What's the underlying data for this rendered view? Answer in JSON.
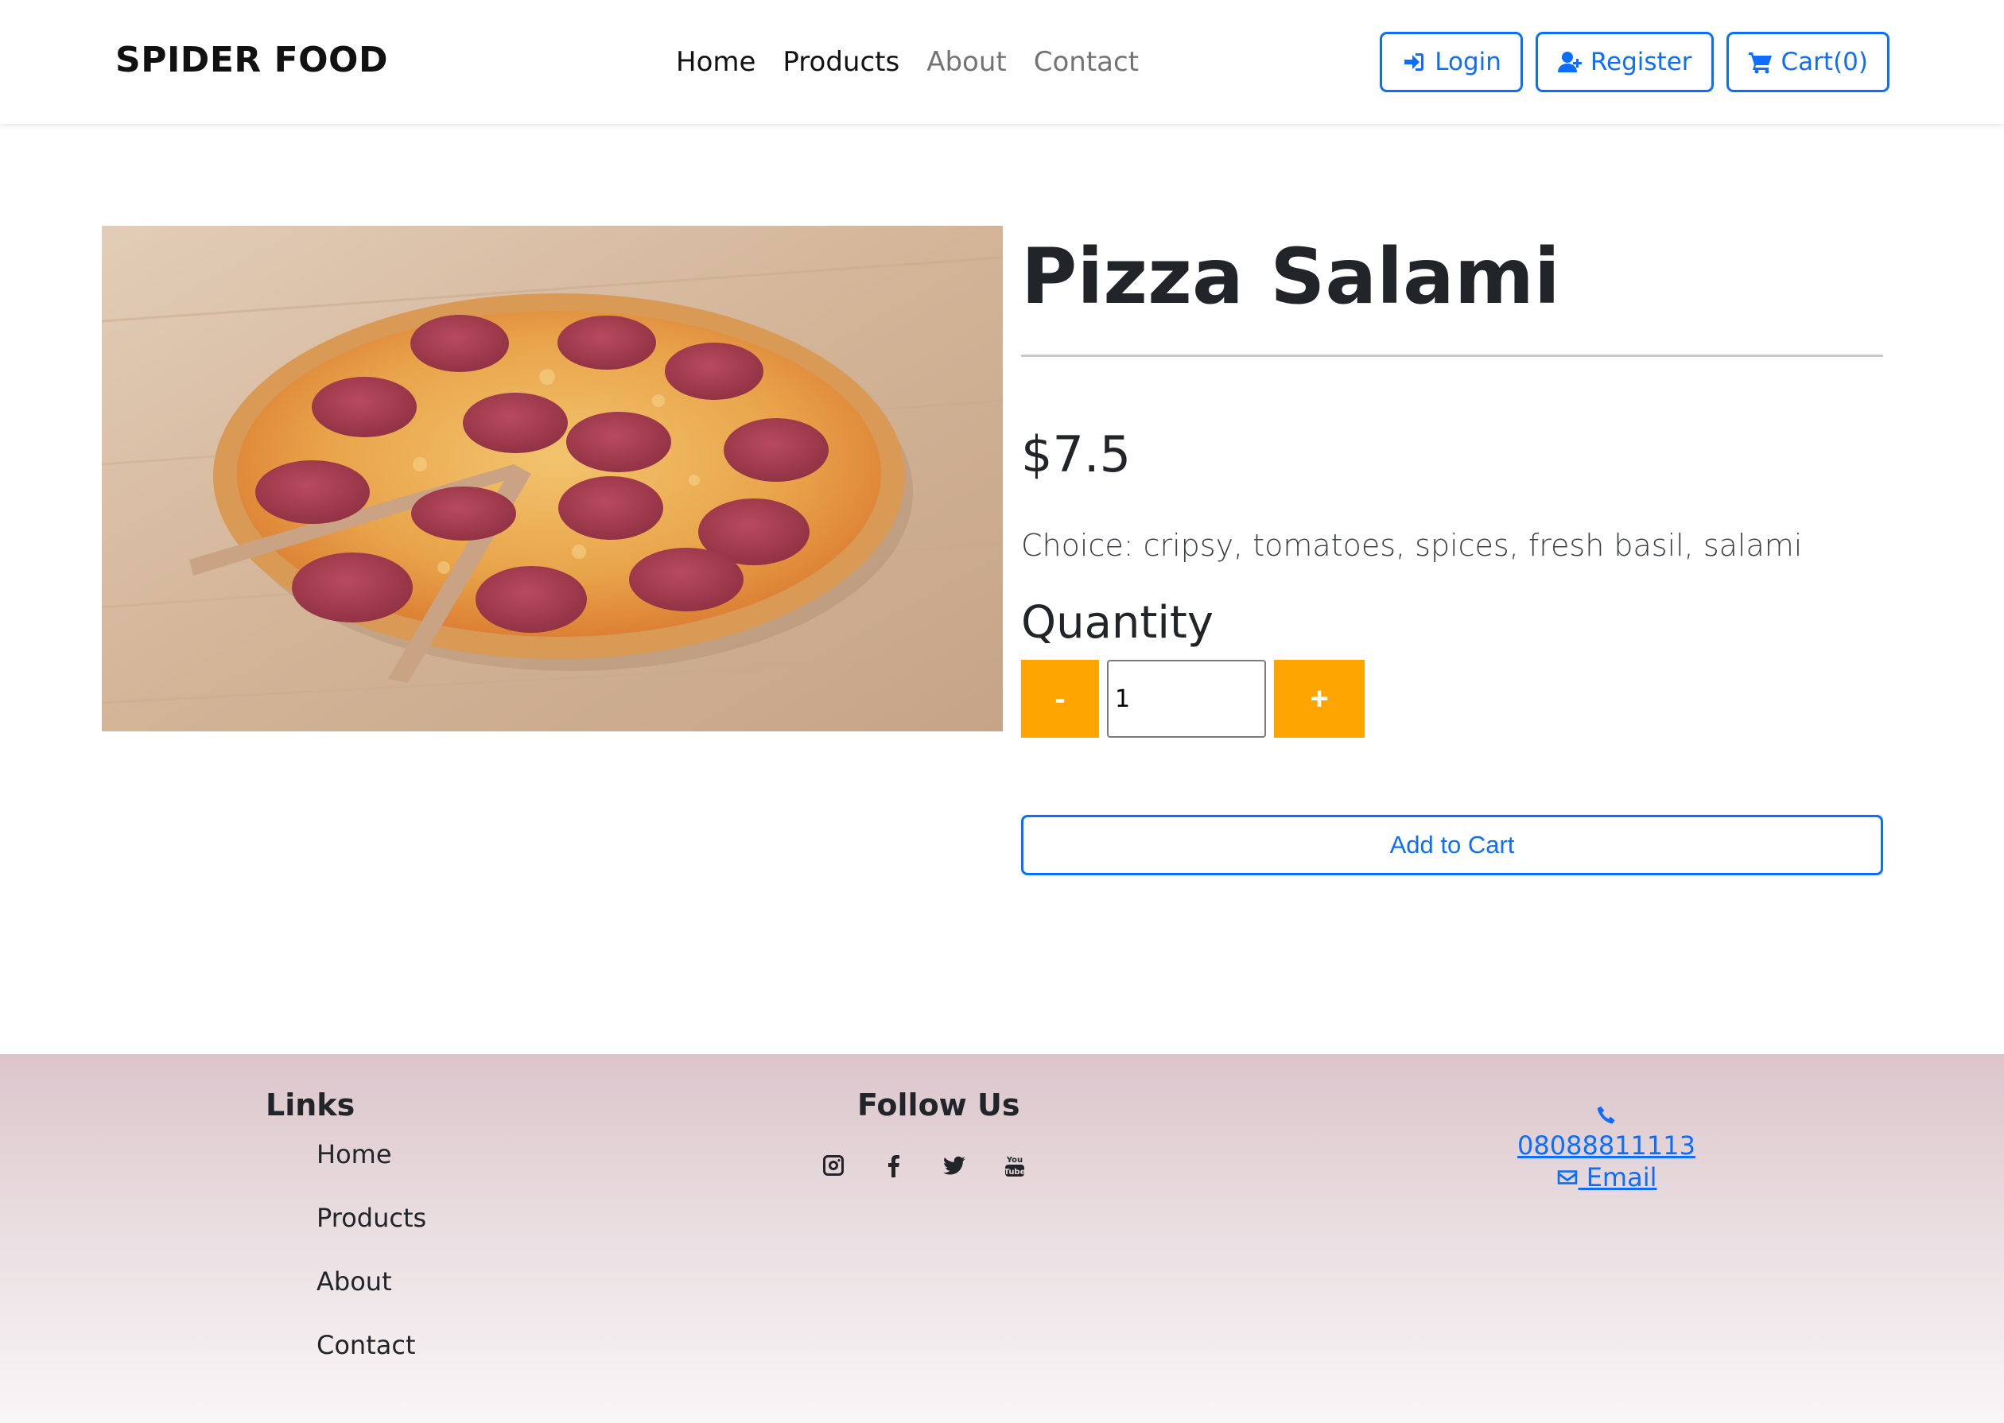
{
  "navbar": {
    "brand": "SPIDER FOOD",
    "links": [
      {
        "label": "Home"
      },
      {
        "label": "Products"
      },
      {
        "label": "About"
      },
      {
        "label": "Contact"
      }
    ],
    "login_label": "Login",
    "register_label": "Register",
    "cart_label": "Cart(0)"
  },
  "product": {
    "title": "Pizza Salami",
    "price": "$7.5",
    "description": "Choice: cripsy, tomatoes, spices, fresh basil, salami",
    "quantity_label": "Quantity",
    "decrement_label": "-",
    "increment_label": "+",
    "quantity_value": "1",
    "add_to_cart_label": "Add to Cart",
    "image_icon": "pizza-photo"
  },
  "footer": {
    "links_title": "Links",
    "links": [
      "Home",
      "Products",
      "About",
      "Contact"
    ],
    "follow_title": "Follow Us",
    "social_icons": [
      "instagram-icon",
      "facebook-icon",
      "twitter-icon",
      "youtube-icon"
    ],
    "phone": " 08088811113",
    "email": " Email"
  },
  "colors": {
    "accent": "#0d6efd",
    "quantity_button": "#ffa500"
  }
}
